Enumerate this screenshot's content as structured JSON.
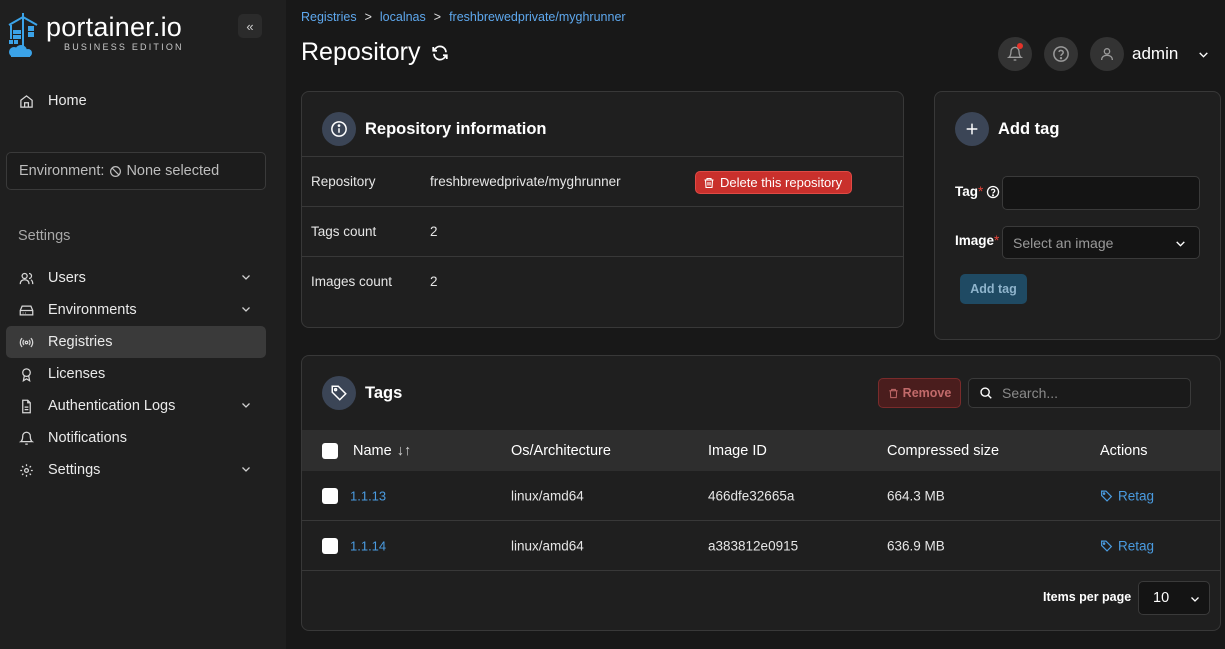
{
  "app": {
    "logo_name": "portainer.io",
    "logo_sub": "BUSINESS EDITION",
    "collapse_glyph": "«"
  },
  "sidebar": {
    "home_label": "Home",
    "environment_prefix": "Environment:",
    "environment_value": "None selected",
    "settings_heading": "Settings",
    "items": [
      {
        "label": "Users",
        "icon": "users-icon",
        "expandable": true
      },
      {
        "label": "Environments",
        "icon": "server-icon",
        "expandable": true
      },
      {
        "label": "Registries",
        "icon": "radio-icon",
        "expandable": false,
        "active": true
      },
      {
        "label": "Licenses",
        "icon": "award-icon",
        "expandable": false
      },
      {
        "label": "Authentication Logs",
        "icon": "file-text-icon",
        "expandable": true
      },
      {
        "label": "Notifications",
        "icon": "bell-icon",
        "expandable": false
      },
      {
        "label": "Settings",
        "icon": "gear-icon",
        "expandable": true
      }
    ]
  },
  "breadcrumb": {
    "items": [
      "Registries",
      "localnas",
      "freshbrewedprivate/myghrunner"
    ],
    "separator": ">"
  },
  "header": {
    "title": "Repository",
    "user": "admin"
  },
  "repo_info": {
    "title": "Repository information",
    "rows": [
      {
        "key": "Repository",
        "value": "freshbrewedprivate/myghrunner"
      },
      {
        "key": "Tags count",
        "value": "2"
      },
      {
        "key": "Images count",
        "value": "2"
      }
    ],
    "delete_label": "Delete this repository"
  },
  "add_tag": {
    "title": "Add tag",
    "tag_label": "Tag",
    "tag_value": "",
    "image_label": "Image",
    "image_placeholder": "Select an image",
    "button_label": "Add tag",
    "required_mark": "*"
  },
  "tags": {
    "title": "Tags",
    "remove_label": "Remove",
    "search_placeholder": "Search...",
    "columns": [
      "Name",
      "Os/Architecture",
      "Image ID",
      "Compressed size",
      "Actions"
    ],
    "sort_glyph": "↓↑",
    "rows": [
      {
        "name": "1.1.13",
        "os": "linux/amd64",
        "image_id": "466dfe32665a",
        "size": "664.3 MB",
        "action": "Retag"
      },
      {
        "name": "1.1.14",
        "os": "linux/amd64",
        "image_id": "a383812e0915",
        "size": "636.9 MB",
        "action": "Retag"
      }
    ],
    "items_per_page_label": "Items per page",
    "items_per_page_value": "10"
  },
  "colors": {
    "accent_link": "#4a9be0",
    "danger": "#c9302c",
    "active_nav": "#3a3a3a",
    "notification_dot": "#e5332a"
  }
}
